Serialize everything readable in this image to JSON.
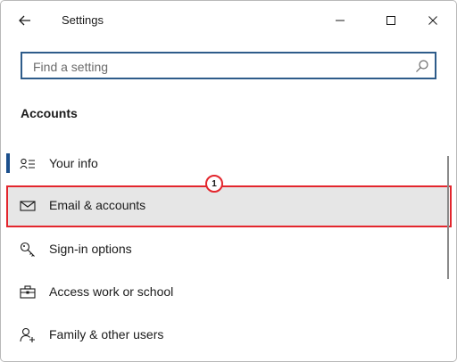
{
  "window": {
    "title": "Settings"
  },
  "search": {
    "placeholder": "Find a setting"
  },
  "section": {
    "title": "Accounts"
  },
  "nav": {
    "items": [
      {
        "label": "Your info",
        "icon": "person-lines-icon",
        "active": true
      },
      {
        "label": "Email & accounts",
        "icon": "envelope-icon",
        "highlighted": true
      },
      {
        "label": "Sign-in options",
        "icon": "key-icon"
      },
      {
        "label": "Access work or school",
        "icon": "briefcase-icon"
      },
      {
        "label": "Family & other users",
        "icon": "add-person-icon"
      }
    ]
  },
  "annotation": {
    "number": "1",
    "color": "#e3262d"
  },
  "colors": {
    "accent": "#1b4f8c",
    "search_border": "#2e5c8a",
    "highlight_bg": "#e6e6e6"
  }
}
